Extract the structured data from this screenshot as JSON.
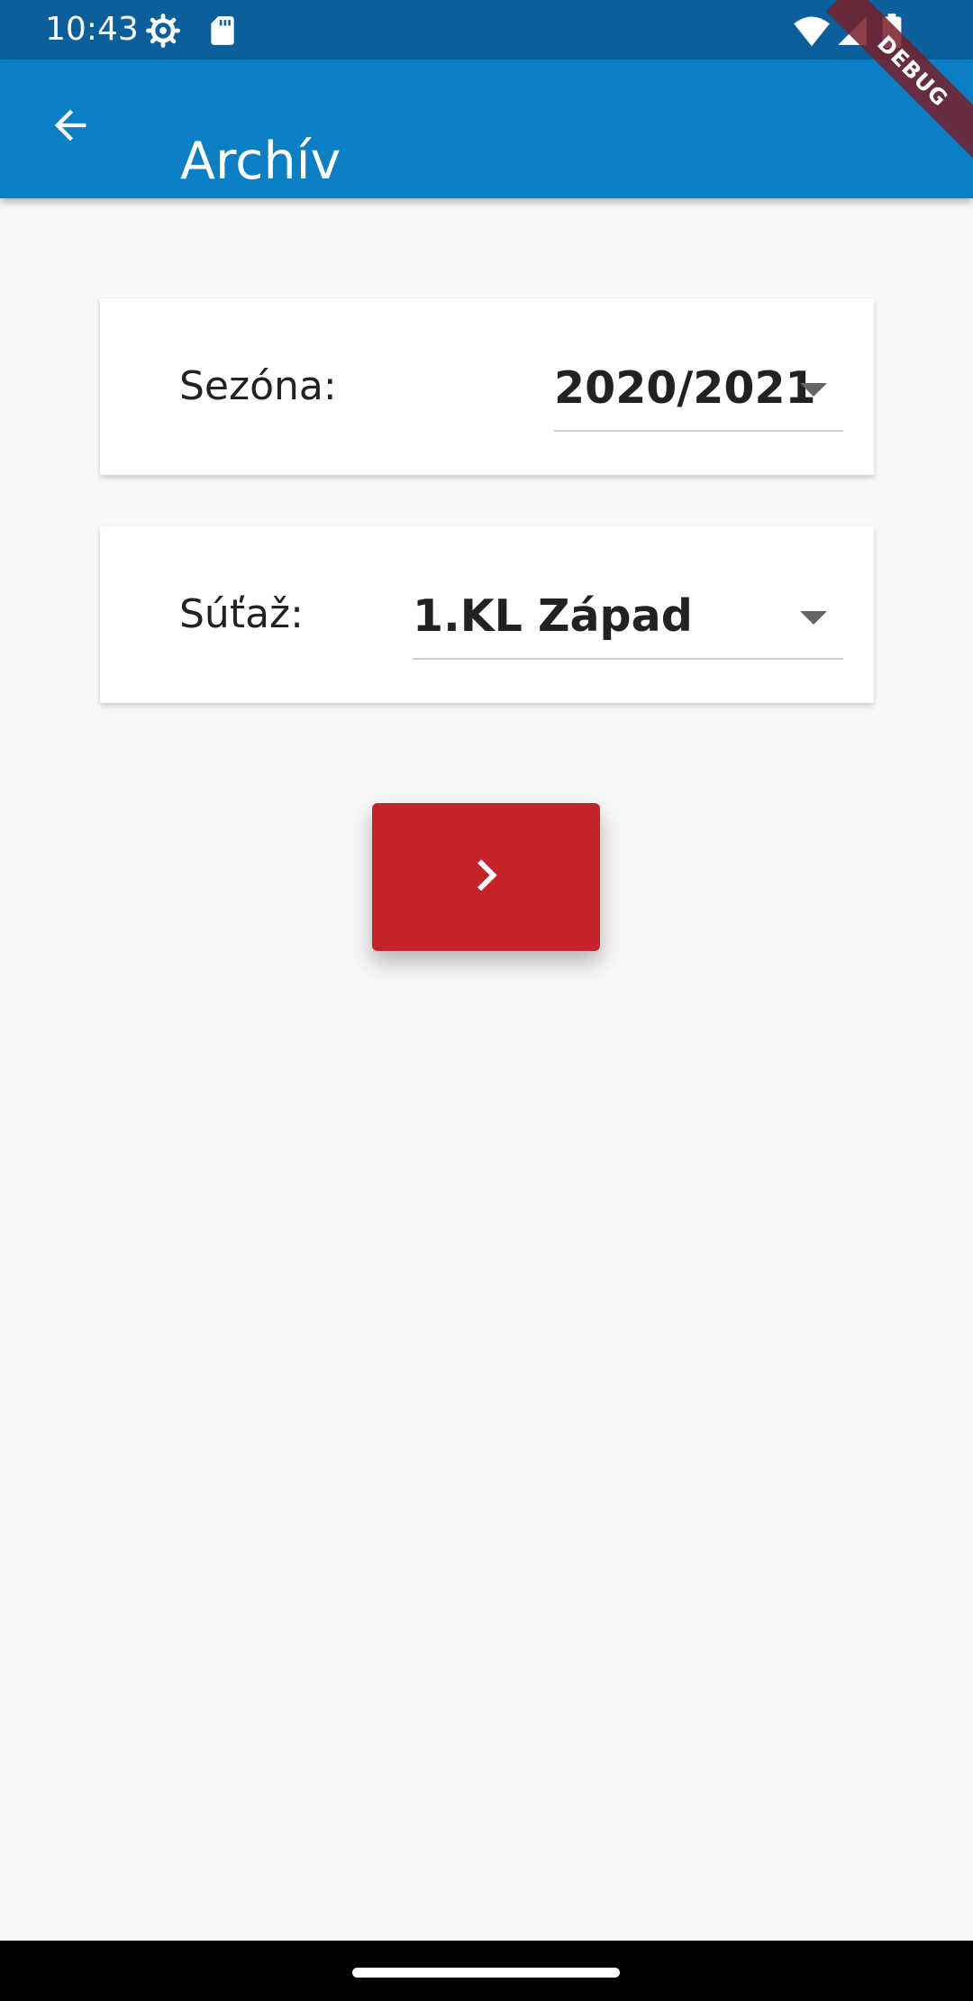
{
  "status_bar": {
    "time": "10:43",
    "left_icons": [
      "settings-gear-icon",
      "sd-card-icon"
    ],
    "right_icons": [
      "wifi-icon",
      "cellular-signal-icon",
      "battery-icon"
    ]
  },
  "debug_banner": {
    "text": "DEBUG"
  },
  "app_bar": {
    "title": "Archív",
    "back_icon": "arrow-back-icon",
    "color": "#0b7fc6"
  },
  "season_card": {
    "label": "Sezóna:",
    "selected_value": "2020/2021"
  },
  "competition_card": {
    "label": "Súťaž:",
    "selected_value": "1.KL Západ"
  },
  "next_button": {
    "icon": "chevron-right-icon",
    "color": "#c4232b"
  },
  "colors": {
    "status_bar": "#0b5f9a",
    "background": "#f8f8f8",
    "debug_banner": "#781e28"
  }
}
